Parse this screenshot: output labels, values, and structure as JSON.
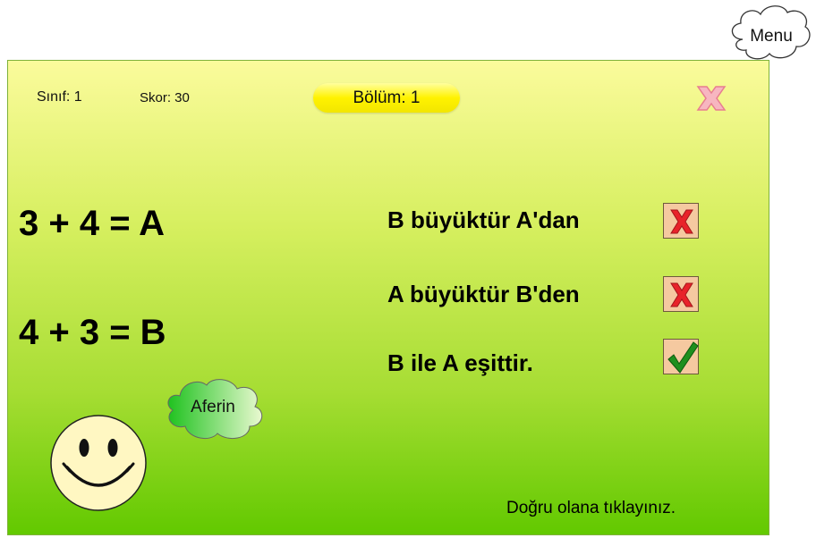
{
  "header": {
    "grade": "Sınıf: 1",
    "score": "Skor: 30",
    "level": "Bölüm: 1"
  },
  "equations": [
    "3 + 4 = A",
    "4 + 3 = B"
  ],
  "options": [
    {
      "text": "B büyüktür A'dan",
      "mark": "x-icon"
    },
    {
      "text": "A büyüktür B'den",
      "mark": "x-icon"
    },
    {
      "text": "B ile A eşittir.",
      "mark": "check-icon"
    }
  ],
  "feedback": "Aferin",
  "instruction": "Doğru olana tıklayınız.",
  "menu": "Menu",
  "colors": {
    "board_top": "#fbfb9c",
    "board_bottom": "#62c900",
    "level_pill": "#fff200",
    "answer_box": "#f5c9a0",
    "x_mark": "#e8232a",
    "check_mark": "#1e8f1e"
  }
}
